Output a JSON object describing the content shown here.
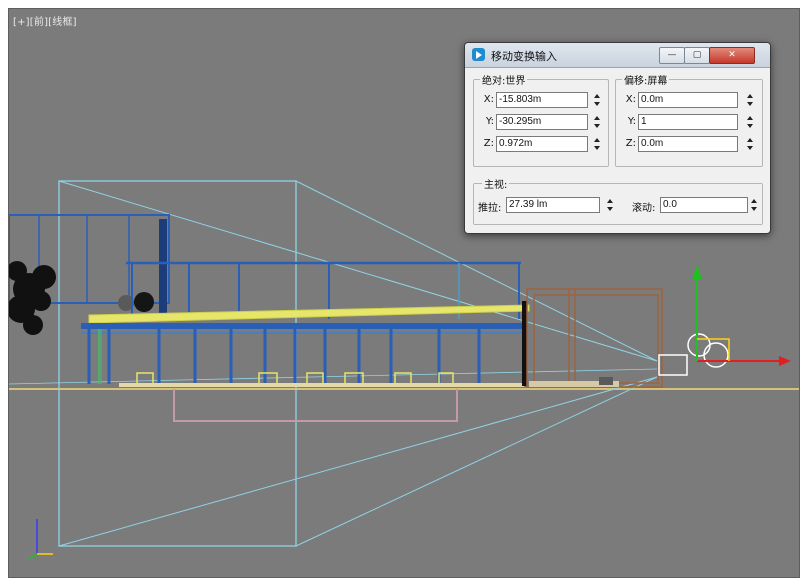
{
  "viewport": {
    "label": "[+][前][线框]",
    "background": "#7b7b7b"
  },
  "dialog": {
    "title": "移动变换输入",
    "buttons": {
      "minimize": "—",
      "maximize": "▢",
      "close": "✕"
    },
    "absolute": {
      "title": "绝对:世界",
      "x_label": "X:",
      "x_value": "-15.803m",
      "y_label": "Y:",
      "y_value": "-30.295m",
      "z_label": "Z:",
      "z_value": "0.972m"
    },
    "offset": {
      "title": "偏移:屏幕",
      "x_label": "X:",
      "x_value": "0.0m",
      "y_label": "Y:",
      "y_value": "1",
      "z_label": "Z:",
      "z_value": "0.0m"
    },
    "camera": {
      "title": "主视:",
      "dolly_label": "推拉:",
      "dolly_value": "27.39 lm",
      "roll_label": "滚动:",
      "roll_value": "0.0"
    }
  },
  "colors": {
    "camera_frustum": "#8fd3e6",
    "building_blue": "#2a5fb8",
    "highlight_yellow": "#e6e66a",
    "gizmo_x": "#e02020",
    "gizmo_y": "#20c020",
    "gizmo_z": "#ffd21a",
    "wood": "#a0623c"
  }
}
